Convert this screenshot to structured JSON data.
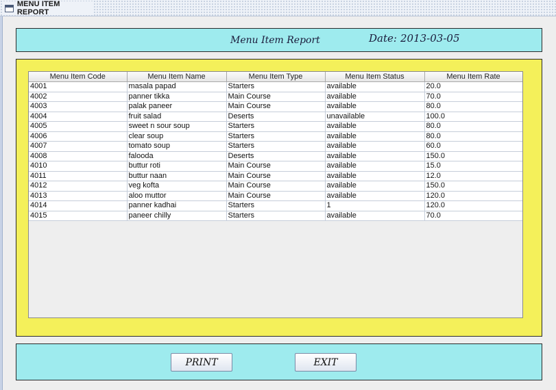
{
  "window": {
    "title": "MENU ITEM REPORT"
  },
  "header": {
    "title": "Menu Item Report",
    "date_label": "Date:",
    "date_value": "2013-03-05"
  },
  "table": {
    "columns": [
      "Menu Item Code",
      "Menu Item Name",
      "Menu Item Type",
      "Menu Item Status",
      "Menu Item Rate"
    ],
    "rows": [
      [
        "4001",
        "masala papad",
        "Starters",
        "available",
        "20.0"
      ],
      [
        "4002",
        "panner tikka",
        "Main Course",
        "available",
        "70.0"
      ],
      [
        "4003",
        "palak paneer",
        "Main Course",
        "available",
        "80.0"
      ],
      [
        "4004",
        "fruit salad",
        "Deserts",
        "unavailable",
        "100.0"
      ],
      [
        "4005",
        "sweet n sour soup",
        "Starters",
        "available",
        "80.0"
      ],
      [
        "4006",
        "clear soup",
        "Starters",
        "available",
        "80.0"
      ],
      [
        "4007",
        "tomato soup",
        "Starters",
        "available",
        "60.0"
      ],
      [
        "4008",
        "falooda",
        "Deserts",
        "available",
        "150.0"
      ],
      [
        "4010",
        "buttur roti",
        "Main Course",
        "available",
        "15.0"
      ],
      [
        "4011",
        "buttur naan",
        "Main Course",
        "available",
        "12.0"
      ],
      [
        "4012",
        "veg kofta",
        "Main Course",
        "available",
        "150.0"
      ],
      [
        "4013",
        "aloo muttor",
        "Main Course",
        "available",
        "120.0"
      ],
      [
        "4014",
        "panner kadhai",
        "Starters",
        "1",
        "120.0"
      ],
      [
        "4015",
        "paneer chilly",
        "Starters",
        "available",
        "70.0"
      ]
    ]
  },
  "buttons": {
    "print_label": "PRINT",
    "exit_label": "EXIT"
  },
  "colors": {
    "cyan_panel": "#9eebee",
    "yellow_panel": "#f4f05a",
    "background": "#eeeeee"
  },
  "icons": {
    "window_icon": "window-icon"
  }
}
